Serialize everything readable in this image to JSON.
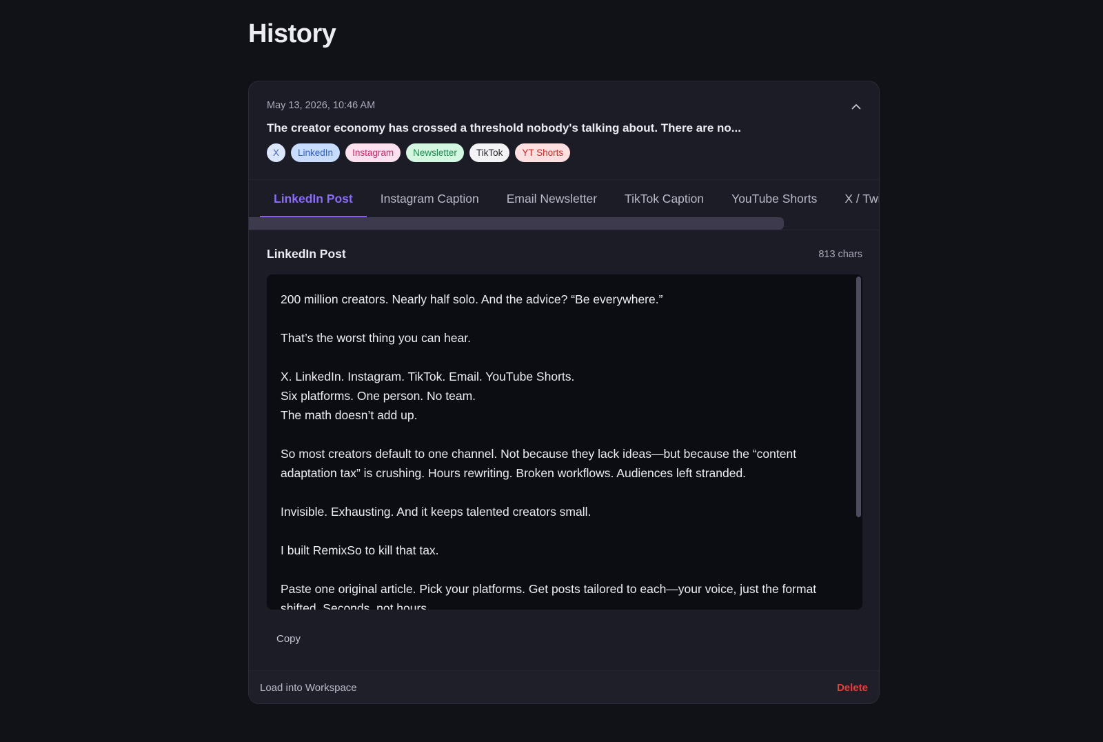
{
  "page": {
    "title": "History"
  },
  "entry": {
    "timestamp": "May 13, 2026, 10:46 AM",
    "snippet": "The creator economy has crossed a threshold nobody's talking about. There are no...",
    "chips": [
      {
        "label": "X",
        "style": "x"
      },
      {
        "label": "LinkedIn",
        "style": "linkedin"
      },
      {
        "label": "Instagram",
        "style": "instagram"
      },
      {
        "label": "Newsletter",
        "style": "newsletter"
      },
      {
        "label": "TikTok",
        "style": "tiktok"
      },
      {
        "label": "YT Shorts",
        "style": "ytshorts"
      }
    ],
    "collapse_icon": "chevron-up-icon"
  },
  "tabs": [
    {
      "label": "LinkedIn Post",
      "active": true
    },
    {
      "label": "Instagram Caption",
      "active": false
    },
    {
      "label": "Email Newsletter",
      "active": false
    },
    {
      "label": "TikTok Caption",
      "active": false
    },
    {
      "label": "YouTube Shorts",
      "active": false
    },
    {
      "label": "X / Twitter",
      "active": false
    }
  ],
  "output": {
    "title": "LinkedIn Post",
    "char_count": "813 chars",
    "paragraphs": [
      [
        "200 million creators. Nearly half solo. And the advice? “Be everywhere.”"
      ],
      [
        "That’s the worst thing you can hear."
      ],
      [
        "X. LinkedIn. Instagram. TikTok. Email. YouTube Shorts.",
        "Six platforms. One person. No team.",
        "The math doesn’t add up."
      ],
      [
        "So most creators default to one channel. Not because they lack ideas—but because the “content adaptation tax” is crushing. Hours rewriting. Broken workflows. Audiences left stranded."
      ],
      [
        "Invisible. Exhausting. And it keeps talented creators small."
      ],
      [
        "I built RemixSo to kill that tax."
      ],
      [
        "Paste one original article. Pick your platforms. Get posts tailored to each—your voice, just the format shifted. Seconds, not hours."
      ]
    ],
    "copy_label": "Copy"
  },
  "footer": {
    "load_label": "Load into Workspace",
    "delete_label": "Delete"
  },
  "colors": {
    "accent": "#8b5cf6",
    "danger": "#ef3b3b",
    "background": "#111218",
    "card": "#1b1c25"
  }
}
